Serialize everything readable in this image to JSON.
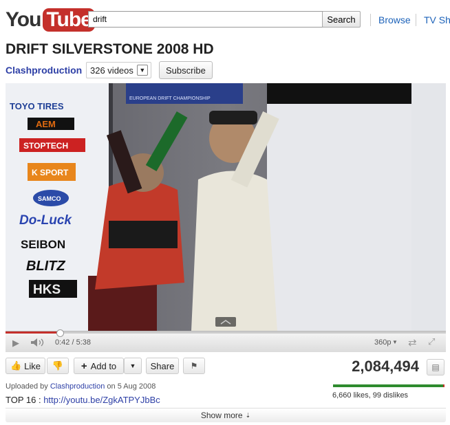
{
  "header": {
    "logo_you": "You",
    "logo_tube": "Tube",
    "search": {
      "value": "drift",
      "button": "Search"
    },
    "nav": [
      "Browse",
      "TV Sho"
    ]
  },
  "video": {
    "title": "DRIFT SILVERSTONE 2008 HD",
    "channel": "Clashproduction",
    "channel_videos": "326 videos",
    "subscribe": "Subscribe",
    "sponsors": [
      "TOYO TIRES",
      "AEM",
      "STOPTECH",
      "K SPORT",
      "SAMCO",
      "Do-Luck",
      "SEIBON",
      "BLITZ",
      "HKS"
    ],
    "banner": "EUROPEAN DRIFT CHAMPIONSHIP"
  },
  "player": {
    "time": "0:42 / 5:38",
    "quality": "360p",
    "progress": 0.124
  },
  "actions": {
    "like": "Like",
    "add_to": "Add to",
    "share": "Share"
  },
  "stats": {
    "views": "2,084,494",
    "likes_text": "6,660 likes, 99 dislikes",
    "like_ratio": 0.985
  },
  "info": {
    "uploaded_prefix": "Uploaded by",
    "uploader": "Clashproduction",
    "date_text": "on 5 Aug 2008",
    "desc_prefix": "TOP 16 :",
    "desc_link": "http://youtu.be/ZgkATPYJbBc",
    "show_more": "Show more"
  },
  "colors": {
    "brand": "#c4302b",
    "link": "#1c62b9",
    "channel": "#2d3fa6"
  }
}
